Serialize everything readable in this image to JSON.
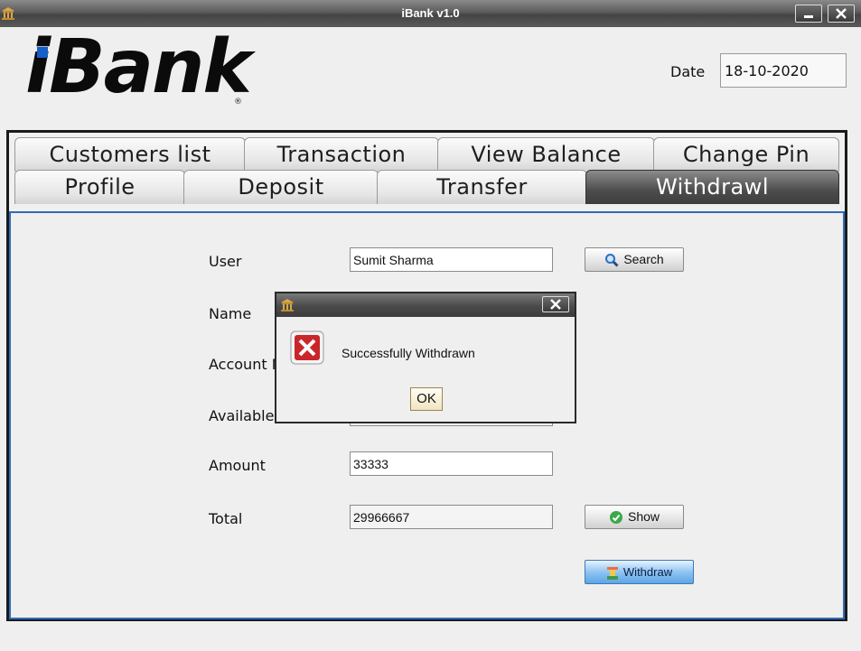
{
  "window": {
    "title": "iBank v1.0",
    "minimize_icon": "minimize-icon",
    "close_icon": "close-icon",
    "app_icon": "bank-icon"
  },
  "header": {
    "logo_text": "iBank",
    "logo_reg": "®",
    "date_label": "Date",
    "date_value": "18-10-2020",
    "accent": "#1660c9"
  },
  "tabs": {
    "row1": [
      {
        "label": "Customers list"
      },
      {
        "label": "Transaction"
      },
      {
        "label": "View Balance"
      },
      {
        "label": "Change Pin"
      }
    ],
    "row2": [
      {
        "label": "Profile"
      },
      {
        "label": "Deposit"
      },
      {
        "label": "Transfer"
      },
      {
        "label": "Withdrawl"
      }
    ],
    "active": "Withdrawl"
  },
  "form": {
    "user_label": "User",
    "user_value": "Sumit Sharma",
    "search_label": "Search",
    "search_icon": "search-icon",
    "name_label": "Name",
    "account_label": "Account N",
    "available_label": "Available",
    "amount_label": "Amount",
    "amount_value": "33333",
    "total_label": "Total",
    "total_value": "29966667",
    "show_label": "Show",
    "show_icon": "check-icon",
    "withdraw_label": "Withdraw",
    "withdraw_icon": "withdraw-icon"
  },
  "dialog": {
    "message": "Successfully Withdrawn",
    "ok_label": "OK",
    "icon": "error-icon"
  }
}
